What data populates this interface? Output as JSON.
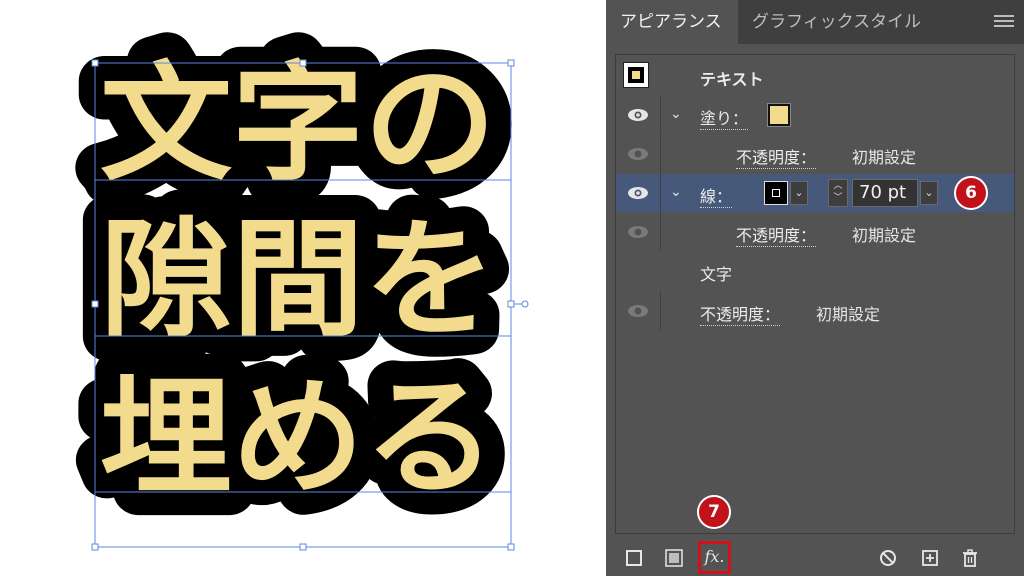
{
  "artboard": {
    "lines": [
      {
        "text": "文字の"
      },
      {
        "text": "隙間を"
      },
      {
        "text": "埋める"
      }
    ],
    "text_color": "#f2db8c",
    "stroke_color": "#000000",
    "selection_color": "#3d6fd6"
  },
  "panel": {
    "tabs": {
      "appearance": "アピアランス",
      "graphic_styles": "グラフィックスタイル"
    },
    "header": {
      "title": "テキスト"
    },
    "fill": {
      "label": "塗り："
    },
    "fill_opacity": {
      "label": "不透明度：",
      "value": "初期設定"
    },
    "stroke": {
      "label": "線：",
      "weight": "70 pt"
    },
    "stroke_opacity": {
      "label": "不透明度：",
      "value": "初期設定"
    },
    "characters": {
      "label": "文字"
    },
    "opacity": {
      "label": "不透明度：",
      "value": "初期設定"
    },
    "badges": {
      "stroke_step": "6",
      "fx_step": "7"
    },
    "bottom_bar": {
      "fx_label": "fx."
    }
  },
  "colors": {
    "panel_bg": "#535353",
    "selected_row": "#46597a",
    "badge": "#c1121c"
  }
}
